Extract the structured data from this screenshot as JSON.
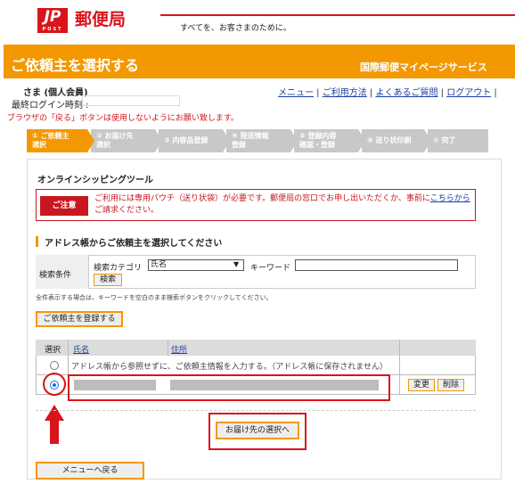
{
  "header": {
    "logo_text": "郵便局",
    "logo_mark": "JP",
    "logo_sub": "POST",
    "tagline": "すべてを、お客さまのために。"
  },
  "title_bar": {
    "title": "ご依頼主を選択する",
    "service": "国際郵便マイページサービス"
  },
  "user": {
    "name": "さま (個人会員)",
    "last_login_label": "最終ログイン時刻 :"
  },
  "nav": {
    "menu": "メニュー",
    "usage": "ご利用方法",
    "faq": "よくあるご質問",
    "logout": "ログアウト"
  },
  "warning": "ブラウザの「戻る」ボタンは使用しないようにお願い致します。",
  "steps": [
    {
      "line1": "① ご依頼主",
      "line2": "選択"
    },
    {
      "line1": "② お届け先",
      "line2": "選択"
    },
    {
      "line1": "③ 内容品登録",
      "line2": ""
    },
    {
      "line1": "④ 発送情報",
      "line2": "登録"
    },
    {
      "line1": "⑤ 登録内容",
      "line2": "確認・登録"
    },
    {
      "line1": "⑥ 送り状印刷",
      "line2": ""
    },
    {
      "line1": "⑦ 完了",
      "line2": ""
    }
  ],
  "tool_title": "オンラインシッピングツール",
  "notice": {
    "badge": "ご注意",
    "text1": "ご利用には専用パウチ（送り状袋）が必要です。郵便局の窓口でお申し出いただくか、事前に",
    "link": "こちらから",
    "text2": "ご請求ください。"
  },
  "section_title": "アドレス帳からご依頼主を選択してください",
  "search": {
    "label": "検索条件",
    "category_label": "検索カテゴリ",
    "category_value": "氏名",
    "keyword_label": "キーワード",
    "keyword_value": "",
    "button": "検索",
    "hint": "全件表示する場合は、キーワードを空白のまま検索ボタンをクリックしてください。"
  },
  "register_button": "ご依頼主を登録する",
  "table": {
    "headers": [
      "選択",
      "氏名",
      "住所"
    ],
    "row1_text": "アドレス帳から参照せずに、ご依頼主情報を入力する。（アドレス帳に保存されません）",
    "edit_button": "変更",
    "delete_button": "削除"
  },
  "next_button": "お届け先の選択へ",
  "back_button": "メニューへ戻る",
  "colors": {
    "brand_red": "#d9141b",
    "accent_orange": "#f39800",
    "link_blue": "#1a3ea6"
  }
}
